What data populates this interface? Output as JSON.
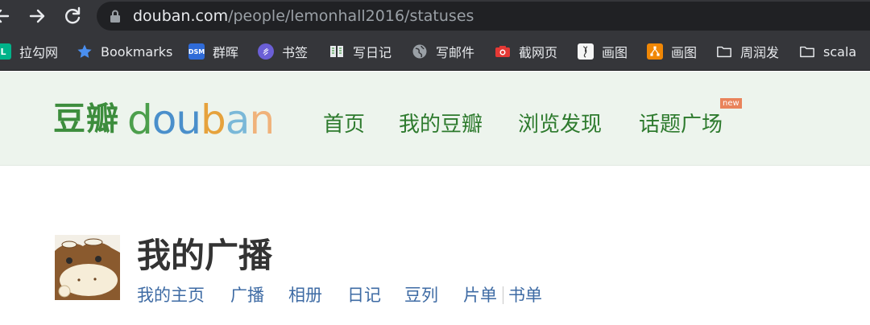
{
  "browser": {
    "url_host": "douban.com",
    "url_path": "/people/lemonhall2016/statuses",
    "bookmarks": [
      {
        "label": "拉勾网",
        "icon": "lagou-icon"
      },
      {
        "label": "Bookmarks",
        "icon": "star-icon"
      },
      {
        "label": "群晖",
        "icon": "dsm-icon",
        "icon_text": "DSM"
      },
      {
        "label": "书签",
        "icon": "link-circle-icon"
      },
      {
        "label": "写日记",
        "icon": "book-icon"
      },
      {
        "label": "写邮件",
        "icon": "globe-icon"
      },
      {
        "label": "截网页",
        "icon": "camera-icon"
      },
      {
        "label": "画图",
        "icon": "drawing-icon"
      },
      {
        "label": "画图",
        "icon": "draw-io-icon"
      },
      {
        "label": "周润发",
        "icon": "folder-icon"
      },
      {
        "label": "scala",
        "icon": "folder-icon"
      }
    ]
  },
  "douban": {
    "logo_cn": "豆瓣",
    "logo_en": [
      "d",
      "o",
      "u",
      "b",
      "a",
      "n"
    ],
    "nav": [
      "首页",
      "我的豆瓣",
      "浏览发现",
      "话题广场"
    ],
    "new_badge": "new",
    "brand_color": "#2d7a2d",
    "nav_bg": "#edf4ed"
  },
  "profile": {
    "title": "我的广播",
    "links": [
      "我的主页",
      "广播",
      "相册",
      "日记",
      "豆列",
      "片单",
      "书单"
    ],
    "link_color": "#3e6ba4"
  }
}
